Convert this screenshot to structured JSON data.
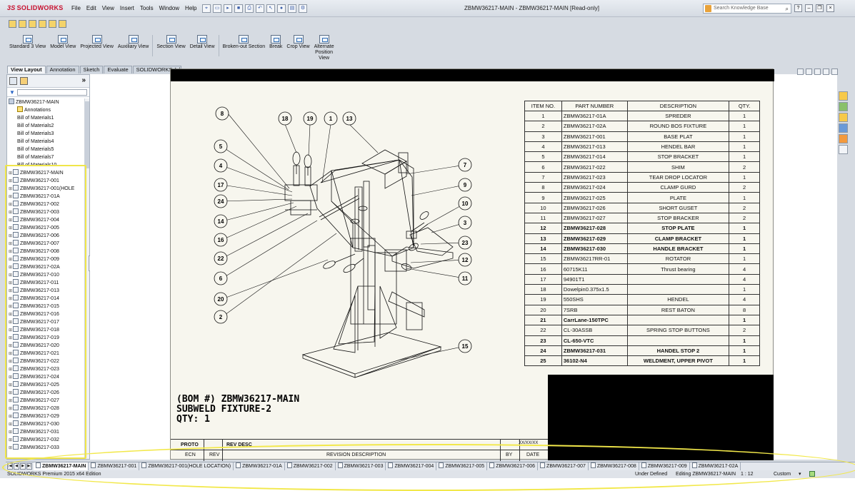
{
  "app": {
    "brand": "SOLIDWORKS",
    "window_title": "ZBMW36217-MAIN - ZBMW36217-MAIN [Read-only]",
    "menu": [
      "File",
      "Edit",
      "View",
      "Insert",
      "Tools",
      "Window",
      "Help"
    ],
    "search_placeholder": "Search Knowledge Base"
  },
  "commands": [
    {
      "label": "Standard 3 View"
    },
    {
      "label": "Model View"
    },
    {
      "label": "Projected View"
    },
    {
      "label": "Auxiliary View"
    },
    {
      "label": "Section View"
    },
    {
      "label": "Detail View"
    },
    {
      "label": "Broken-out Section"
    },
    {
      "label": "Break"
    },
    {
      "label": "Crop View"
    },
    {
      "label": "Alternate Position View"
    }
  ],
  "tabs": [
    "View Layout",
    "Annotation",
    "Sketch",
    "Evaluate",
    "SOLIDWORKS Add-Ins"
  ],
  "tree": {
    "root": "ZBMW36217-MAIN",
    "items_fixed": [
      "Annotations",
      "Bill of Materials1",
      "Bill of Materials2",
      "Bill of Materials3",
      "Bill of Materials4",
      "Bill of Materials5",
      "Bill of Materials7",
      "Bill of Materials10"
    ],
    "items_sheets": [
      "ZBMW36217-MAIN",
      "ZBMW36217-001",
      "ZBMW36217-001(HOLE",
      "ZBMW36217-01A",
      "ZBMW36217-002",
      "ZBMW36217-003",
      "ZBMW36217-004",
      "ZBMW36217-005",
      "ZBMW36217-006",
      "ZBMW36217-007",
      "ZBMW36217-008",
      "ZBMW36217-009",
      "ZBMW36217-02A",
      "ZBMW36217-010",
      "ZBMW36217-011",
      "ZBMW36217-013",
      "ZBMW36217-014",
      "ZBMW36217-015",
      "ZBMW36217-016",
      "ZBMW36217-017",
      "ZBMW36217-018",
      "ZBMW36217-019",
      "ZBMW36217-020",
      "ZBMW36217-021",
      "ZBMW36217-022",
      "ZBMW36217-023",
      "ZBMW36217-024",
      "ZBMW36217-025",
      "ZBMW36217-026",
      "ZBMW36217-027",
      "ZBMW36217-028",
      "ZBMW36217-029",
      "ZBMW36217-030",
      "ZBMW36217-031",
      "ZBMW36217-032",
      "ZBMW36217-033"
    ]
  },
  "bom": {
    "headers": [
      "ITEM NO.",
      "PART NUMBER",
      "DESCRIPTION",
      "QTY."
    ],
    "rows": [
      {
        "item": "1",
        "part": "ZBMW36217-01A",
        "desc": "SPREDER",
        "qty": "1",
        "bold": false
      },
      {
        "item": "2",
        "part": "ZBMW36217-02A",
        "desc": "ROUND BOS FIXTURE",
        "qty": "1",
        "bold": false
      },
      {
        "item": "3",
        "part": "ZBMW36217-001",
        "desc": "BASE PLAT",
        "qty": "1",
        "bold": false
      },
      {
        "item": "4",
        "part": "ZBMW36217-013",
        "desc": "HENDEL BAR",
        "qty": "1",
        "bold": false
      },
      {
        "item": "5",
        "part": "ZBMW36217-014",
        "desc": "STOP BRACKET",
        "qty": "1",
        "bold": false
      },
      {
        "item": "6",
        "part": "ZBMW36217-022",
        "desc": "SHIM",
        "qty": "2",
        "bold": false
      },
      {
        "item": "7",
        "part": "ZBMW36217-023",
        "desc": "TEAR DROP LOCATOR",
        "qty": "1",
        "bold": false
      },
      {
        "item": "8",
        "part": "ZBMW36217-024",
        "desc": "CLAMP GURD",
        "qty": "2",
        "bold": false
      },
      {
        "item": "9",
        "part": "ZBMW36217-025",
        "desc": "PLATE",
        "qty": "1",
        "bold": false
      },
      {
        "item": "10",
        "part": "ZBMW36217-026",
        "desc": "SHORT GUSET",
        "qty": "2",
        "bold": false
      },
      {
        "item": "11",
        "part": "ZBMW36217-027",
        "desc": "STOP BRACKER",
        "qty": "2",
        "bold": false
      },
      {
        "item": "12",
        "part": "ZBMW36217-028",
        "desc": "STOP PLATE",
        "qty": "1",
        "bold": true
      },
      {
        "item": "13",
        "part": "ZBMW36217-029",
        "desc": "CLAMP BRACKET",
        "qty": "1",
        "bold": true
      },
      {
        "item": "14",
        "part": "ZBMW36217-030",
        "desc": "HANDLE BRACKET",
        "qty": "1",
        "bold": true
      },
      {
        "item": "15",
        "part": "ZBMW36217RR-01",
        "desc": "ROTATOR",
        "qty": "1",
        "bold": false
      },
      {
        "item": "16",
        "part": "60715K11",
        "desc": "Thrust bearing",
        "qty": "4",
        "bold": false
      },
      {
        "item": "17",
        "part": "94901T1",
        "desc": "",
        "qty": "4",
        "bold": false
      },
      {
        "item": "18",
        "part": "Dowelpin0.375x1.5",
        "desc": "",
        "qty": "1",
        "bold": false
      },
      {
        "item": "19",
        "part": "550SHS",
        "desc": "HENDEL",
        "qty": "4",
        "bold": false
      },
      {
        "item": "20",
        "part": "7SRB",
        "desc": "REST BATON",
        "qty": "8",
        "bold": false
      },
      {
        "item": "21",
        "part": "CarrLane-150TPC",
        "desc": "",
        "qty": "1",
        "bold": true
      },
      {
        "item": "22",
        "part": "CL-30ASSB",
        "desc": "SPRING STOP BUTTONS",
        "qty": "2",
        "bold": false
      },
      {
        "item": "23",
        "part": "CL-650-VTC",
        "desc": "",
        "qty": "1",
        "bold": true
      },
      {
        "item": "24",
        "part": "ZBMW36217-031",
        "desc": "HANDEL STOP 2",
        "qty": "1",
        "bold": true
      },
      {
        "item": "25",
        "part": "36102-N4",
        "desc": "WELDMENT, UPPER PIVOT",
        "qty": "1",
        "bold": true
      }
    ]
  },
  "drawing": {
    "title_line1": "(BOM #) ZBMW36217-MAIN",
    "title_line2": "SUBWELD FIXTURE-2",
    "title_line3": "QTY: 1",
    "balloons": [
      "8",
      "18",
      "19",
      "1",
      "13",
      "5",
      "4",
      "17",
      "24",
      "14",
      "16",
      "22",
      "6",
      "20",
      "2",
      "7",
      "9",
      "10",
      "3",
      "23",
      "12",
      "11",
      "15"
    ]
  },
  "revision": {
    "proto": "PROTO",
    "rev_desc": "REV DESC",
    "small": "XX/XX/XX",
    "h_ecn": "ECN",
    "h_rev": "REV",
    "h_desc": "REVISION DESCRIPTION",
    "h_by": "BY",
    "h_date": "DATE"
  },
  "doc_tabs": [
    "ZBMW36217-MAIN",
    "ZBMW36217-001",
    "ZBMW36217-001(HOLE LOCATION)",
    "ZBMW36217-01A",
    "ZBMW36217-002",
    "ZBMW36217-003",
    "ZBMW36217-004",
    "ZBMW36217-005",
    "ZBMW36217-006",
    "ZBMW36217-007",
    "ZBMW36217-008",
    "ZBMW36217-009",
    "ZBMW36217-02A"
  ],
  "status": {
    "edition": "SOLIDWORKS Premium 2015 x64 Edition",
    "defined": "Under Defined",
    "editing": "Editing ZBMW36217-MAIN",
    "scale": "1 : 12",
    "units": "Custom"
  }
}
